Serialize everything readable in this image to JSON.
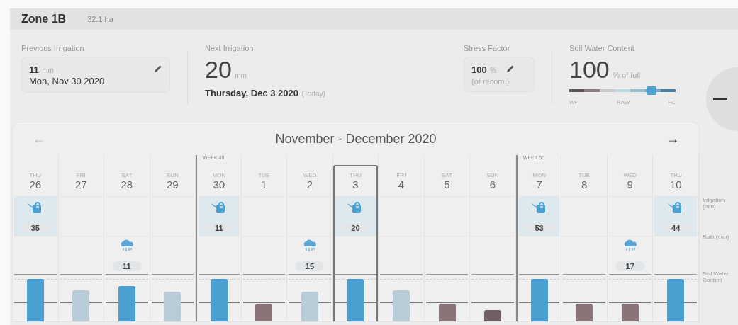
{
  "zone": {
    "name": "Zone 1B",
    "area": "32.1 ha"
  },
  "previous_irrigation": {
    "label": "Previous Irrigation",
    "amount": "11",
    "unit": "mm",
    "date": "Mon, Nov 30 2020"
  },
  "next_irrigation": {
    "label": "Next Irrigation",
    "amount": "20",
    "unit": "mm",
    "date": "Thursday, Dec 3 2020",
    "note": "(Today)"
  },
  "stress_factor": {
    "label": "Stress Factor",
    "value": "100",
    "unit": "%",
    "note": "(of recom.)"
  },
  "soil_water_content": {
    "label": "Soil Water Content",
    "value": "100",
    "unit": "% of full",
    "level": 0.8,
    "scale": [
      "WP",
      "RAW",
      "FC"
    ]
  },
  "calendar": {
    "title": "November - December 2020",
    "prev": {
      "label": "←",
      "disabled": true
    },
    "next": {
      "label": "→",
      "disabled": false
    },
    "row_labels": [
      "Irrigation (mm)",
      "Rain (mm)",
      "Soil Water Content"
    ],
    "days": [
      {
        "weekday": "THU",
        "date": "26",
        "selected": false,
        "irrigation": "35",
        "soil": {
          "level": 1.0,
          "color": "#4b9fd1"
        }
      },
      {
        "weekday": "FRI",
        "date": "27",
        "selected": false,
        "soil": {
          "level": 0.74,
          "color": "#b9cdd8"
        }
      },
      {
        "weekday": "SAT",
        "date": "28",
        "selected": false,
        "rain": "11",
        "soil": {
          "level": 0.84,
          "color": "#4b9fd1"
        }
      },
      {
        "weekday": "SUN",
        "date": "29",
        "selected": false,
        "soil": {
          "level": 0.7,
          "color": "#b9cdd8"
        }
      },
      {
        "weekday": "MON",
        "date": "30",
        "week": "WEEK 49",
        "selected": false,
        "irrigation": "11",
        "soil": {
          "level": 1.0,
          "color": "#4b9fd1"
        }
      },
      {
        "weekday": "TUE",
        "date": "1",
        "selected": false,
        "soil": {
          "level": 0.42,
          "color": "#8a7477"
        }
      },
      {
        "weekday": "WED",
        "date": "2",
        "selected": false,
        "rain": "15",
        "soil": {
          "level": 0.7,
          "color": "#b9cdd8"
        }
      },
      {
        "weekday": "THU",
        "date": "3",
        "selected": true,
        "irrigation": "20",
        "soil": {
          "level": 1.0,
          "color": "#4b9fd1"
        }
      },
      {
        "weekday": "FRI",
        "date": "4",
        "selected": false,
        "soil": {
          "level": 0.74,
          "color": "#b9cdd8"
        }
      },
      {
        "weekday": "SAT",
        "date": "5",
        "selected": false,
        "soil": {
          "level": 0.42,
          "color": "#8a7477"
        }
      },
      {
        "weekday": "SUN",
        "date": "6",
        "selected": false,
        "soil": {
          "level": 0.27,
          "color": "#6f5f62"
        }
      },
      {
        "weekday": "MON",
        "date": "7",
        "week": "WEEK 50",
        "selected": false,
        "irrigation": "53",
        "soil": {
          "level": 1.0,
          "color": "#4b9fd1"
        }
      },
      {
        "weekday": "TUE",
        "date": "8",
        "selected": false,
        "soil": {
          "level": 0.42,
          "color": "#8a7477"
        }
      },
      {
        "weekday": "WED",
        "date": "9",
        "selected": false,
        "rain": "17",
        "soil": {
          "level": 0.42,
          "color": "#8a7477"
        }
      },
      {
        "weekday": "THU",
        "date": "10",
        "selected": false,
        "irrigation": "44",
        "soil": {
          "level": 1.0,
          "color": "#4b9fd1"
        }
      }
    ]
  }
}
